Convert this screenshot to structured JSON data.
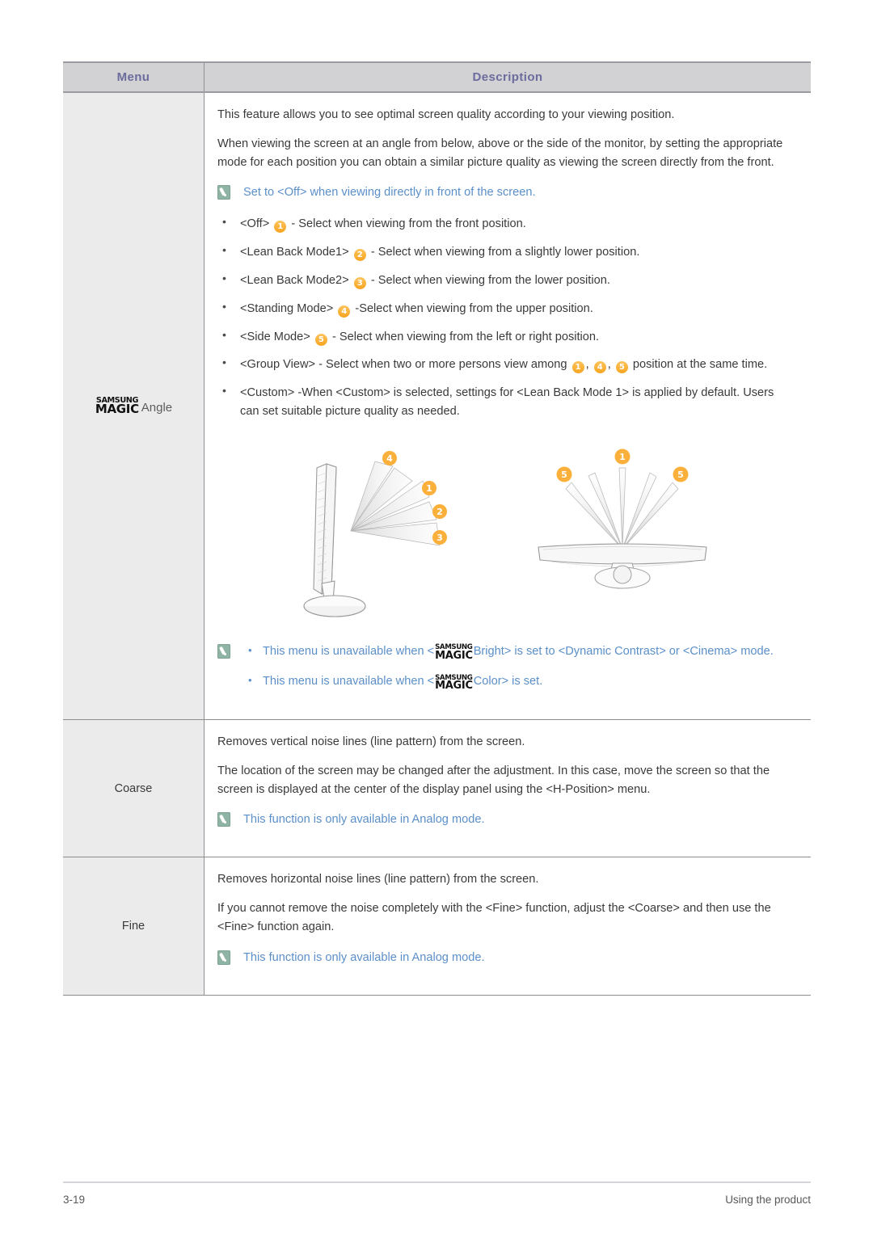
{
  "table": {
    "headers": {
      "menu": "Menu",
      "description": "Description"
    },
    "rows": {
      "angle": {
        "menu_logo_line1": "SAMSUNG",
        "menu_logo_line2": "MAGIC",
        "menu_word": "Angle",
        "para1": "This feature allows you to see optimal screen quality according to your viewing position.",
        "para2": "When viewing the screen at an angle from below, above or the side of the monitor, by setting the appropriate mode for each position you can obtain a similar picture quality as viewing the screen directly from the front.",
        "note_top": "Set to <Off> when viewing directly in front of the screen.",
        "bullets": [
          {
            "label": "<Off>",
            "badge": "1",
            "text": "- Select when viewing from the front position."
          },
          {
            "label": "<Lean Back Mode1>",
            "badge": "2",
            "text": "- Select when viewing from a slightly lower position."
          },
          {
            "label": "<Lean Back Mode2>",
            "badge": "3",
            "text": "- Select when viewing from the lower position."
          },
          {
            "label": "<Standing Mode>",
            "badge": "4",
            "text": "-Select when viewing from the upper position."
          },
          {
            "label": "<Side Mode>",
            "badge": "5",
            "text": "- Select when viewing from the left or right position."
          }
        ],
        "group_view": {
          "prefix": "<Group View>  - Select when two or more persons view among",
          "badges": [
            "1",
            "4",
            "5"
          ],
          "suffix": "position at the same time."
        },
        "custom": " <Custom> -When <Custom> is selected, settings for <Lean Back Mode 1> is applied by default. Users can set suitable picture quality as needed.",
        "notes_bottom": [
          {
            "pre": "This menu is unavailable when <",
            "logo_line1": "SAMSUNG",
            "logo_line2": "MAGIC",
            "post": "Bright> is set to <Dynamic Contrast> or <Cinema> mode."
          },
          {
            "pre": "This menu is unavailable when <",
            "logo_line1": "SAMSUNG",
            "logo_line2": "MAGIC",
            "post": "Color> is set."
          }
        ],
        "figure_labels": {
          "side_view": [
            "4",
            "1",
            "2",
            "3"
          ],
          "top_view": [
            "5",
            "1",
            "5"
          ]
        }
      },
      "coarse": {
        "menu": "Coarse",
        "para1": "Removes vertical noise lines (line pattern) from the screen.",
        "para2": "The location of the screen may be changed after the adjustment. In this case, move the screen so that the screen is displayed at the center of the display panel using the <H-Position> menu.",
        "note": "This function is only available in Analog mode."
      },
      "fine": {
        "menu": "Fine",
        "para1": "Removes horizontal noise lines (line pattern) from the screen.",
        "para2": "If you cannot remove the noise completely with the <Fine> function, adjust the <Coarse> and then use the <Fine> function again.",
        "note": "This function is only available in Analog mode."
      }
    }
  },
  "footer": {
    "page_number": "3-19",
    "section": "Using the product"
  },
  "colors": {
    "note_text": "#5b8fc9",
    "badge": "#fbb03b",
    "header_text": "#6b6b9e",
    "header_bg": "#d2d2d4",
    "menu_cell_bg": "#ebebeb"
  }
}
